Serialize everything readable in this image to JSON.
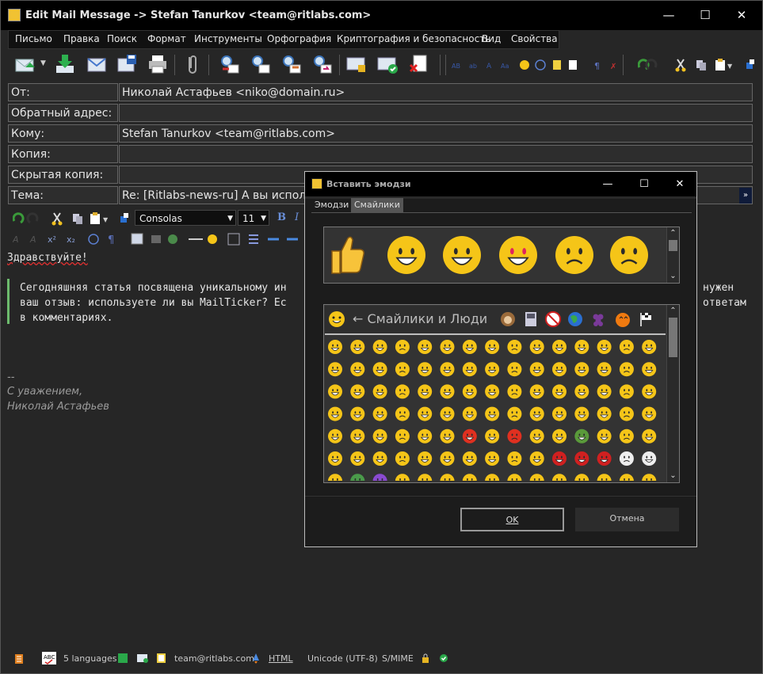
{
  "window": {
    "title": "Edit Mail Message -> Stefan Tanurkov <team@ritlabs.com>"
  },
  "menu": [
    "Письмо",
    "Правка",
    "Поиск",
    "Формат",
    "Инструменты",
    "Орфография",
    "Криптография и безопасность",
    "Вид",
    "Свойства"
  ],
  "headers": [
    {
      "label": "От:",
      "value": "Николай Астафьев <niko@domain.ru>"
    },
    {
      "label": "Обратный адрес:",
      "value": ""
    },
    {
      "label": "Кому:",
      "value": "Stefan Tanurkov <team@ritlabs.com>"
    },
    {
      "label": "Копия:",
      "value": ""
    },
    {
      "label": "Скрытая копия:",
      "value": ""
    },
    {
      "label": "Тема:",
      "value": "Re: [Ritlabs-news-ru] А вы использ"
    }
  ],
  "format": {
    "font": "Consolas",
    "size": "11"
  },
  "body": {
    "greeting": "Здравствуйте!",
    "quote": [
      "Сегодняшняя статья посвящена уникальному ин",
      "ваш отзыв: используете ли вы MailTicker? Ес",
      "в комментариях."
    ],
    "quote_right": [
      "нужен",
      "ответам"
    ],
    "sig": [
      "--",
      "С уважением,",
      "Николай Астафьев"
    ]
  },
  "status": {
    "languages": "5 languages",
    "account": "team@ritlabs.com",
    "format": "HTML",
    "encoding": "Unicode (UTF-8)",
    "security": "S/MIME"
  },
  "dialog": {
    "title": "Вставить эмодзи",
    "tabs": [
      "Эмодзи",
      "Смайлики"
    ],
    "category": "← Смайлики и Люди",
    "ok": "OK",
    "cancel": "Отмена"
  }
}
